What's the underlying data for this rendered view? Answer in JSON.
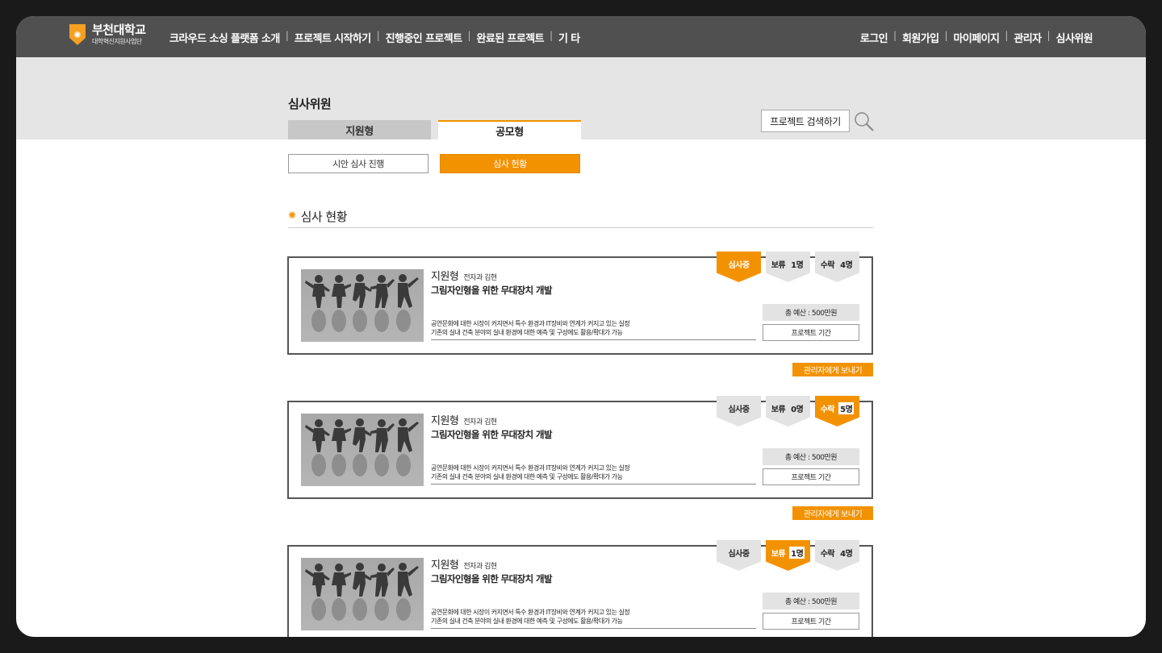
{
  "header": {
    "logo_name": "부천대학교",
    "logo_sub": "대학혁신지원사업단",
    "nav": [
      "크라우드 소싱 플랫폼 소개",
      "프로젝트 시작하기",
      "진행중인 프로젝트",
      "완료된 프로젝트",
      "기 타"
    ],
    "util": [
      "로그인",
      "회원가입",
      "마이페이지",
      "관리자",
      "심사위원"
    ]
  },
  "page": {
    "title": "심사위원",
    "tabs": [
      "지원형",
      "공모형"
    ],
    "active_tab": "공모형",
    "search_label": "프로젝트 검색하기",
    "subtabs": [
      "시안 심사 진행",
      "심사 현황"
    ],
    "active_subtab": "심사 현황",
    "section_title": "심사 현황"
  },
  "cards": [
    {
      "type": "지원형",
      "dept": "전자과 김현",
      "title": "그림자인형을 위한 무대장치 개발",
      "desc1": "공연문화에 대한 시장이 커지면서 특수 환경과 IT장비와 연계가 커지고 있는 실정",
      "desc2": "기존의 실내 건축 분야의 실내 환경에 대한 예측 및 구성에도 활용/확대가 가능",
      "budget": "총 예산 : 500만원",
      "period": "프로젝트 기간",
      "flags": [
        {
          "label": "심사중",
          "count": "",
          "active": true
        },
        {
          "label": "보류",
          "count": "1명",
          "active": false
        },
        {
          "label": "수락",
          "count": "4명",
          "active": false
        }
      ],
      "send_label": "관리자에게 보내기"
    },
    {
      "type": "지원형",
      "dept": "전자과 김현",
      "title": "그림자인형을 위한 무대장치 개발",
      "desc1": "공연문화에 대한 시장이 커지면서 특수 환경과 IT장비와 연계가 커지고 있는 실정",
      "desc2": "기존의 실내 건축 분야의 실내 환경에 대한 예측 및 구성에도 활용/확대가 가능",
      "budget": "총 예산 : 500만원",
      "period": "프로젝트 기간",
      "flags": [
        {
          "label": "심사중",
          "count": "",
          "active": false
        },
        {
          "label": "보류",
          "count": "0명",
          "active": false
        },
        {
          "label": "수락",
          "count": "5명",
          "active": true
        }
      ],
      "send_label": "관리자에게 보내기"
    },
    {
      "type": "지원형",
      "dept": "전자과 김현",
      "title": "그림자인형을 위한 무대장치 개발",
      "desc1": "공연문화에 대한 시장이 커지면서 특수 환경과 IT장비와 연계가 커지고 있는 실정",
      "desc2": "기존의 실내 건축 분야의 실내 환경에 대한 예측 및 구성에도 활용/확대가 가능",
      "budget": "총 예산 : 500만원",
      "period": "프로젝트 기간",
      "flags": [
        {
          "label": "심사중",
          "count": "",
          "active": false
        },
        {
          "label": "보류",
          "count": "1명",
          "active": true
        },
        {
          "label": "수락",
          "count": "4명",
          "active": false
        }
      ],
      "send_label": ""
    }
  ],
  "colors": {
    "accent": "#f39200",
    "header": "#505050",
    "band": "#e5e5e5"
  }
}
